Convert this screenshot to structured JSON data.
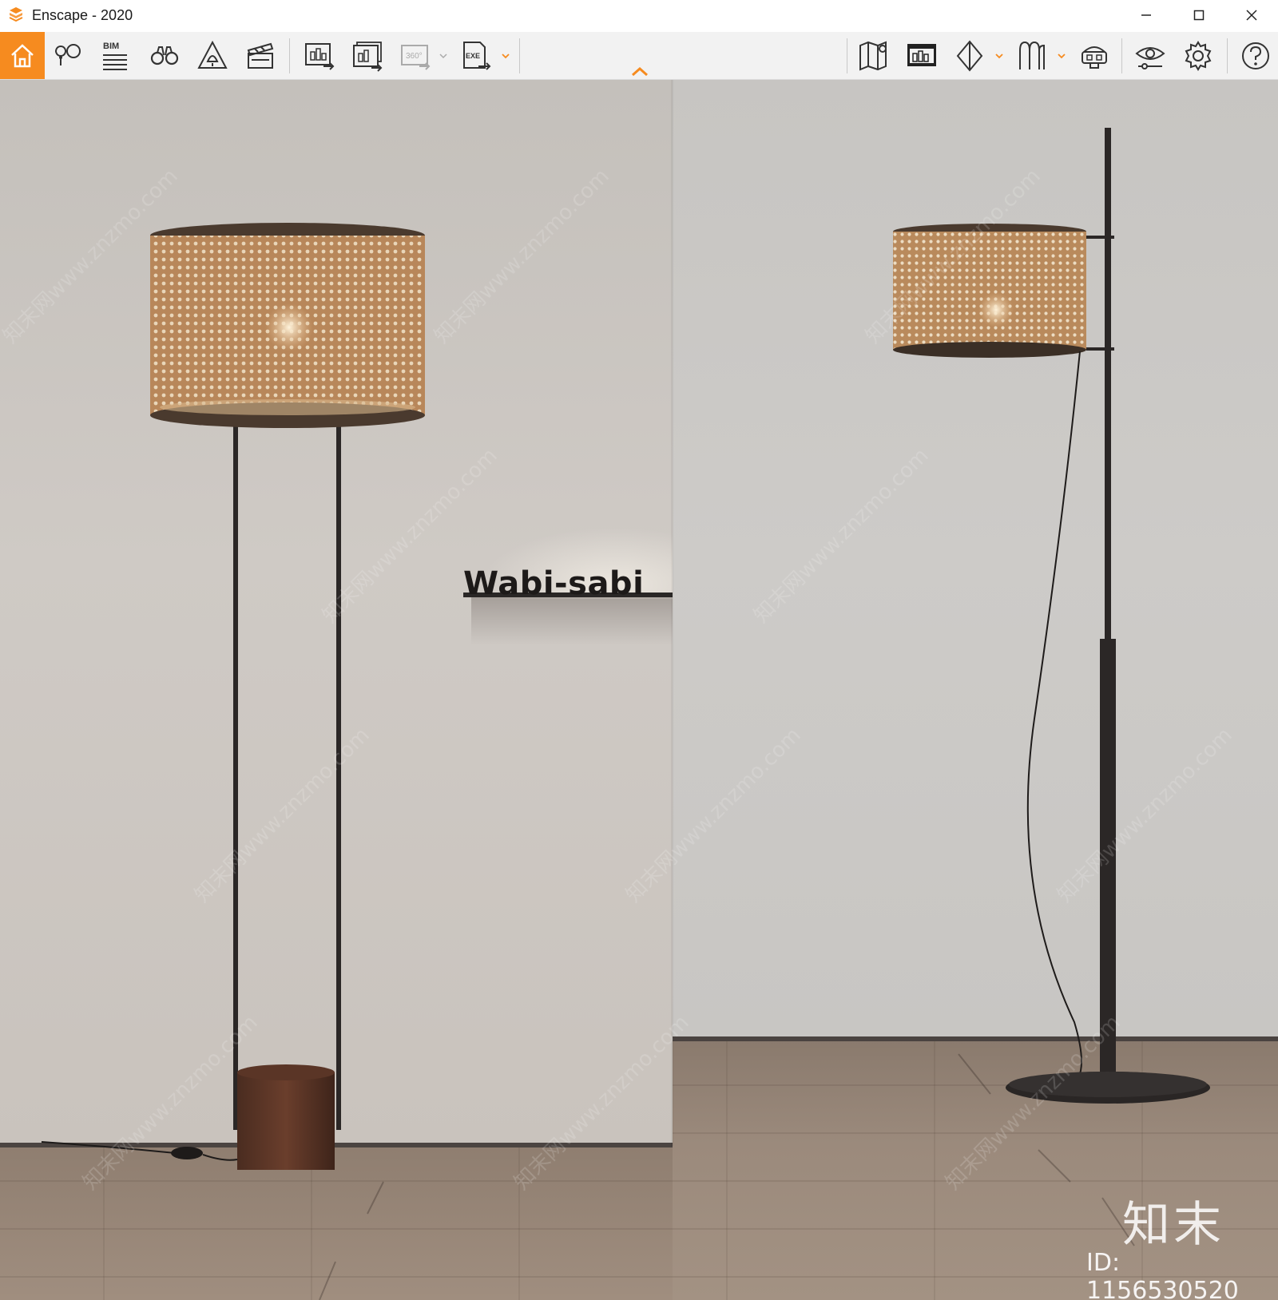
{
  "window": {
    "title": "Enscape - 2020",
    "accent_color": "#f68b1f"
  },
  "toolbar": {
    "left_buttons": [
      {
        "name": "home",
        "icon": "home-icon",
        "active": true
      },
      {
        "name": "capture-location",
        "icon": "map-pin-icon"
      },
      {
        "name": "bim",
        "icon": "bim-icon",
        "label": "BIM"
      },
      {
        "name": "views",
        "icon": "binoculars-icon"
      },
      {
        "name": "objects",
        "icon": "light-triangle-icon"
      },
      {
        "name": "video-editor",
        "icon": "clapperboard-icon"
      },
      {
        "name": "render-screenshot",
        "icon": "render-image-icon"
      },
      {
        "name": "batch-render",
        "icon": "batch-render-icon"
      },
      {
        "name": "render-360",
        "icon": "panorama-360-icon",
        "label": "360°",
        "disabled": true
      },
      {
        "name": "export-exe",
        "icon": "export-exe-icon",
        "label": "EXE"
      }
    ],
    "right_buttons": [
      {
        "name": "map",
        "icon": "map-icon"
      },
      {
        "name": "asset-library",
        "icon": "asset-library-icon"
      },
      {
        "name": "view-mode",
        "icon": "view-mode-icon"
      },
      {
        "name": "materials",
        "icon": "materials-icon"
      },
      {
        "name": "vr-headset",
        "icon": "vr-headset-icon"
      },
      {
        "name": "visual-settings",
        "icon": "eye-settings-icon"
      },
      {
        "name": "settings",
        "icon": "gear-icon"
      },
      {
        "name": "help",
        "icon": "help-icon"
      }
    ]
  },
  "viewport": {
    "shelf_label": "Wabi-sabi",
    "watermark_logo": "知末",
    "watermark_id": "ID: 1156530520",
    "watermark_tile": "知末网www.znzmo.com"
  }
}
